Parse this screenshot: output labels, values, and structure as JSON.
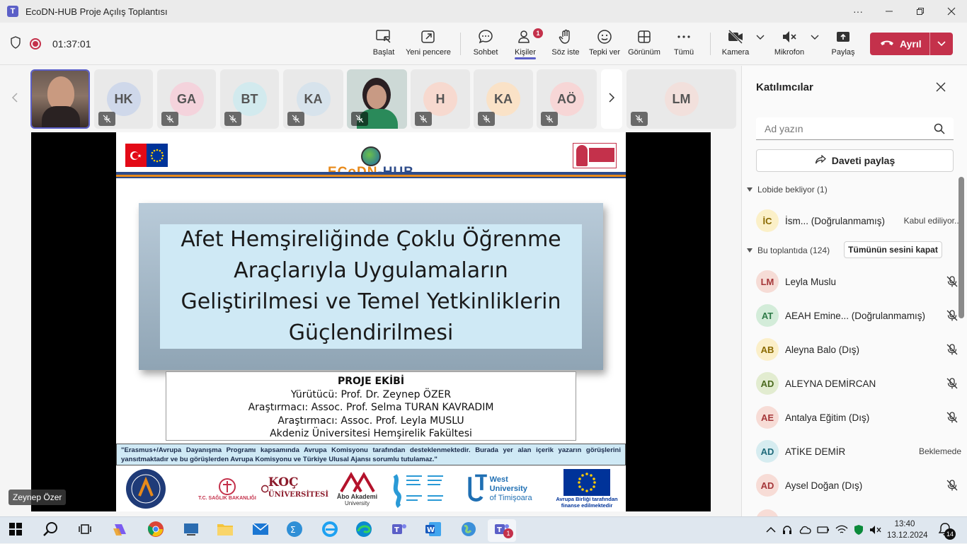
{
  "window": {
    "title": "EcoDN-HUB Proje Açılış Toplantısı"
  },
  "meeting": {
    "timer": "01:37:01"
  },
  "toolbar": {
    "baslat": "Başlat",
    "yeni_pencere": "Yeni pencere",
    "sohbet": "Sohbet",
    "kisiler": "Kişiler",
    "kisiler_badge": "1",
    "soz_iste": "Söz iste",
    "tepki_ver": "Tepki ver",
    "gorunum": "Görünüm",
    "tumu": "Tümü",
    "kamera": "Kamera",
    "mikrofon": "Mikrofon",
    "paylas": "Paylaş",
    "ayril": "Ayrıl"
  },
  "tiles": [
    {
      "initials": "HK",
      "color": "#cfd8ea"
    },
    {
      "initials": "GA",
      "color": "#f4d3dc"
    },
    {
      "initials": "BT",
      "color": "#d2eaee"
    },
    {
      "initials": "KA",
      "color": "#d7e3ec"
    },
    {
      "initials": "H",
      "color": "#f7d9cf"
    },
    {
      "initials": "KA",
      "color": "#fae2c7"
    },
    {
      "initials": "AÖ",
      "color": "#f7d6d6"
    },
    {
      "initials": "LM",
      "color": "#f2e0dc"
    }
  ],
  "presenter": {
    "name": "Zeynep Özer"
  },
  "slide": {
    "title_lines": [
      "Afet Hemşireliğinde Çoklu Öğrenme",
      "Araçlarıyla Uygulamaların",
      "Geliştirilmesi ve Temel Yetkinliklerin",
      "Güçlendirilmesi"
    ],
    "logo_a": "ECoDN",
    "logo_b": "-HUB",
    "team_heading": "PROJE EKİBİ",
    "team_lines": [
      "Yürütücü: Prof. Dr. Zeynep ÖZER",
      "Araştırmacı: Assoc. Prof. Selma TURAN KAVRADIM",
      "Araştırmacı: Assoc. Prof. Leyla MUSLU",
      "Akdeniz Üniversitesi Hemşirelik Fakültesi"
    ],
    "erasmus": "\"Erasmus+/Avrupa Dayanışma Programı kapsamında Avrupa Komisyonu tarafından desteklenmektedir. Burada yer alan içerik yazarın görüşlerini yansıtmaktadır ve bu görüşlerden Avrupa Komisyonu ve Türkiye Ulusal Ajansı sorumlu tutulamaz.\"",
    "logos": {
      "saglik": "T.C. SAĞLIK BAKANLIĞI",
      "koc_a": "KOÇ",
      "koc_b": "ÜNİVERSİTESİ",
      "abo_a": "Åbo Akademi",
      "abo_b": "University",
      "west_a": "West University",
      "west_b": "of Timişoara",
      "eu_a": "Avrupa Birliği tarafından",
      "eu_b": "finanse edilmektedir"
    }
  },
  "panel": {
    "title": "Katılımcılar",
    "search_placeholder": "Ad yazın",
    "invite": "Daveti paylaş",
    "lobby_label": "Lobide bekliyor (1)",
    "lobby": [
      {
        "initials": "İC",
        "name": "İsm...  (Doğrulanmamış)",
        "right": "Kabul ediliyor...",
        "color": "#fbf0c8"
      }
    ],
    "meeting_label": "Bu toplantıda (124)",
    "mute_all": "Tümünün sesini kapat",
    "people": [
      {
        "initials": "LM",
        "name": "Leyla Muslu",
        "right": "",
        "color": "#f6dcd6"
      },
      {
        "initials": "AT",
        "name": "AEAH Emine...  (Doğrulanmamış)",
        "right": "",
        "color": "#d3ecd9"
      },
      {
        "initials": "AB",
        "name": "Aleyna Balo (Dış)",
        "right": "",
        "color": "#fbefc9"
      },
      {
        "initials": "AD",
        "name": "ALEYNA DEMİRCAN",
        "right": "",
        "color": "#e2ecd0"
      },
      {
        "initials": "AE",
        "name": "Antalya Eğitim (Dış)",
        "right": "",
        "color": "#f7dcd6"
      },
      {
        "initials": "AD",
        "name": "ATİKE DEMİR",
        "right": "Beklemede",
        "color": "#d6ecf0"
      },
      {
        "initials": "AD",
        "name": "Aysel Doğan (Dış)",
        "right": "",
        "color": "#f7dcd6"
      }
    ]
  },
  "taskbar": {
    "time": "13:40",
    "date": "13.12.2024",
    "notifications": "14",
    "teams_badge": "1"
  }
}
